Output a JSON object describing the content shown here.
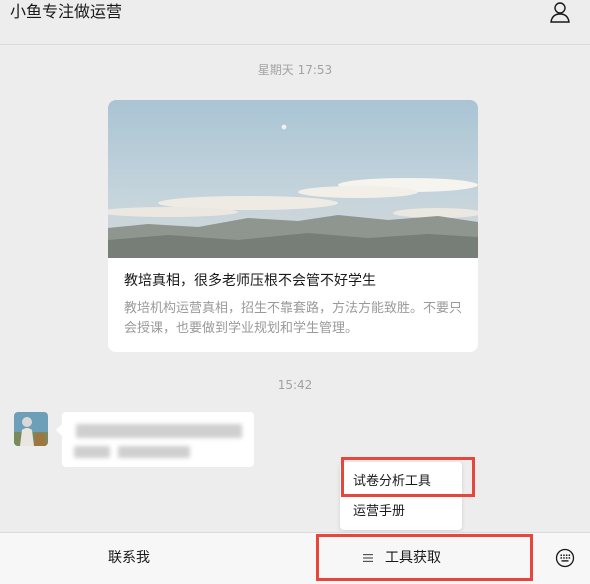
{
  "header": {
    "title": "小鱼专注做运营",
    "profile_icon": "person-outline-icon"
  },
  "timestamps": {
    "first": "星期天 17:53",
    "second": "15:42"
  },
  "article": {
    "title": "教培真相，很多老师压根不会管不好学生",
    "description": "教培机构运营真相，招生不靠套路，方法方能致胜。不要只会授课，也要做到学业规划和学生管理。"
  },
  "popup_menu": {
    "items": [
      "试卷分析工具",
      "运营手册"
    ]
  },
  "bottom_bar": {
    "contact_label": "联系我",
    "menu_icon": "hamburger-menu-icon",
    "tools_label": "工具获取",
    "keyboard_icon": "keyboard-icon"
  },
  "colors": {
    "highlight": "#e8453c",
    "background": "#ededed"
  }
}
